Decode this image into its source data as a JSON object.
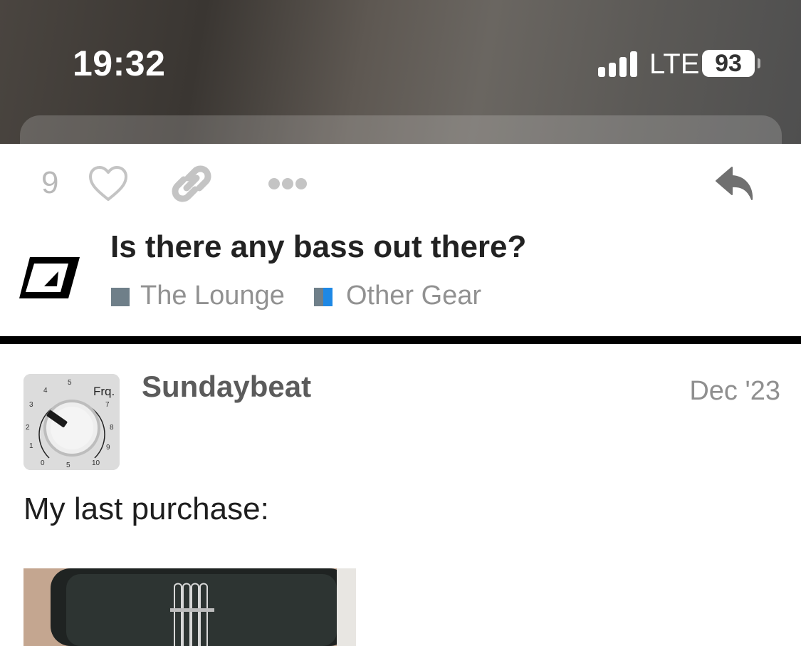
{
  "status_bar": {
    "time": "19:32",
    "network": "LTE",
    "battery": "93",
    "signal_bars": 4
  },
  "actions": {
    "like_count": "9",
    "icons": [
      "heart-icon",
      "link-icon",
      "more-icon",
      "reply-icon"
    ]
  },
  "topic": {
    "title": "Is there any bass out there?",
    "categories": [
      {
        "label": "The Lounge",
        "color": "#6f7f89"
      },
      {
        "label": "Other Gear",
        "color": "#1e88e5"
      }
    ]
  },
  "post": {
    "username": "Sundaybeat",
    "date": "Dec '23",
    "text": "My last purchase:",
    "avatar": {
      "knob_label": "Frq.",
      "dial_numbers": [
        "0",
        "1",
        "2",
        "3",
        "4",
        "5",
        "7",
        "8",
        "9",
        "10",
        "5"
      ]
    }
  },
  "colors": {
    "text_primary": "#222222",
    "text_muted": "#919191",
    "icon_muted": "#c4c4c4",
    "reply_icon": "#707070",
    "divider": "#000000"
  }
}
